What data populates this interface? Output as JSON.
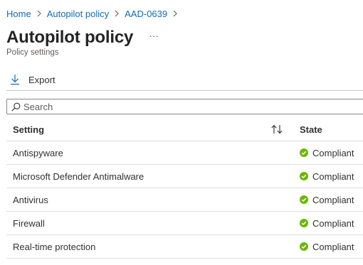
{
  "breadcrumb": {
    "items": [
      "Home",
      "Autopilot policy",
      "AAD-0639"
    ]
  },
  "page": {
    "title": "Autopilot policy",
    "more": "···",
    "subtitle": "Policy settings"
  },
  "toolbar": {
    "export_label": "Export",
    "export_icon": "download-icon"
  },
  "search": {
    "placeholder": "Search",
    "value": "",
    "icon": "search-icon"
  },
  "table": {
    "columns": [
      "Setting",
      "State"
    ],
    "sort_icon": "sort-icon",
    "rows": [
      {
        "setting": "Antispyware",
        "state": "Compliant"
      },
      {
        "setting": "Microsoft Defender Antimalware",
        "state": "Compliant"
      },
      {
        "setting": "Antivirus",
        "state": "Compliant"
      },
      {
        "setting": "Firewall",
        "state": "Compliant"
      },
      {
        "setting": "Real-time protection",
        "state": "Compliant"
      }
    ]
  },
  "colors": {
    "link": "#0f6cbd",
    "compliant": "#6bb700",
    "divider": "#e1dfdd"
  }
}
